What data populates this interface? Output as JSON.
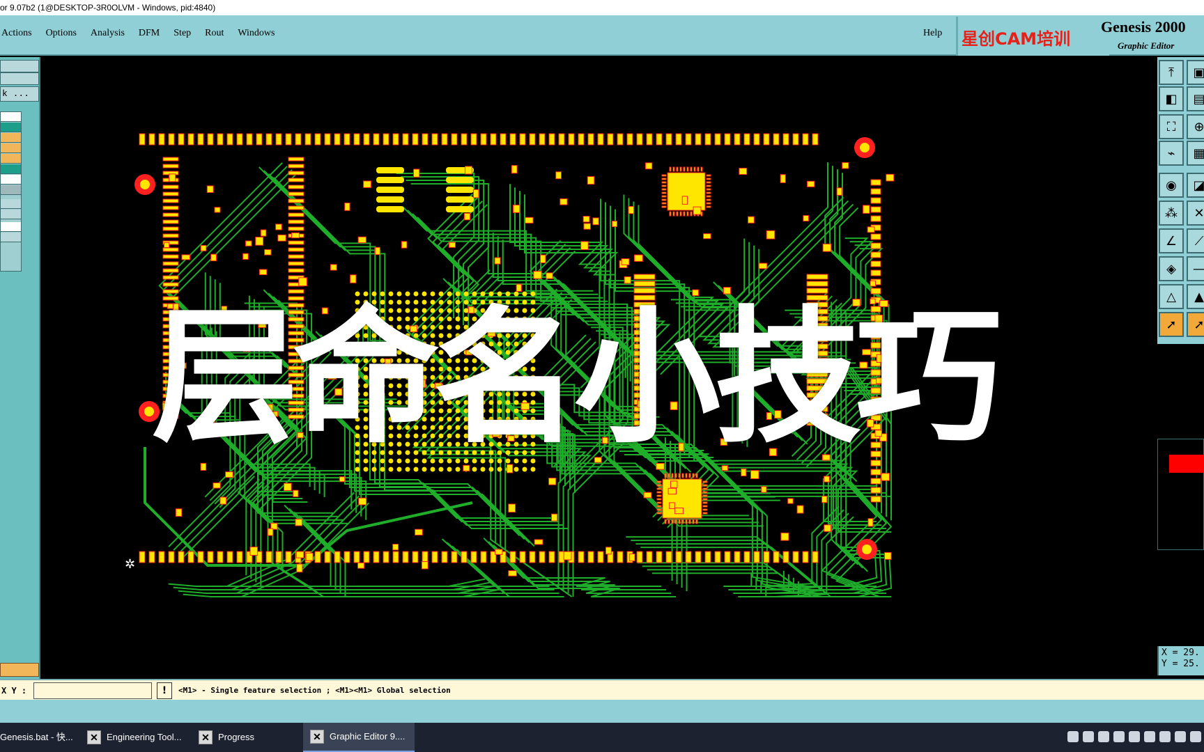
{
  "window": {
    "title": "or 9.07b2 (1@DESKTOP-3R0OLVM - Windows, pid:4840)"
  },
  "menu": {
    "items": [
      {
        "label": "Actions"
      },
      {
        "label": "Options"
      },
      {
        "label": "Analysis"
      },
      {
        "label": "DFM"
      },
      {
        "label": "Step"
      },
      {
        "label": "Rout"
      },
      {
        "label": "Windows"
      }
    ],
    "help": "Help"
  },
  "brand": {
    "watermark": "星创CAM培训",
    "product": "Genesis 2000",
    "subtitle": "Graphic Editor"
  },
  "left_panel": {
    "browse_label": "k ..."
  },
  "overlay": {
    "caption": "层命名小技巧"
  },
  "coords": {
    "text": "X = 29.\nY = 25."
  },
  "status": {
    "xy_label": "X Y :",
    "xy_value": "",
    "warn": "!",
    "message": "<M1> - Single feature selection ; <M1><M1> Global selection"
  },
  "taskbar": {
    "tasks": [
      {
        "label": "Genesis.bat - 快...",
        "active": false
      },
      {
        "label": "Engineering Tool...",
        "active": false
      },
      {
        "label": "Progress",
        "active": false
      },
      {
        "label": "Graphic Editor 9....",
        "active": true
      }
    ]
  },
  "colors": {
    "pad": "#ffe600",
    "pad_edge": "#ff2020",
    "trace": "#1fae2a",
    "panel": "#8fcfd5",
    "accent_red": "#e8201a"
  }
}
